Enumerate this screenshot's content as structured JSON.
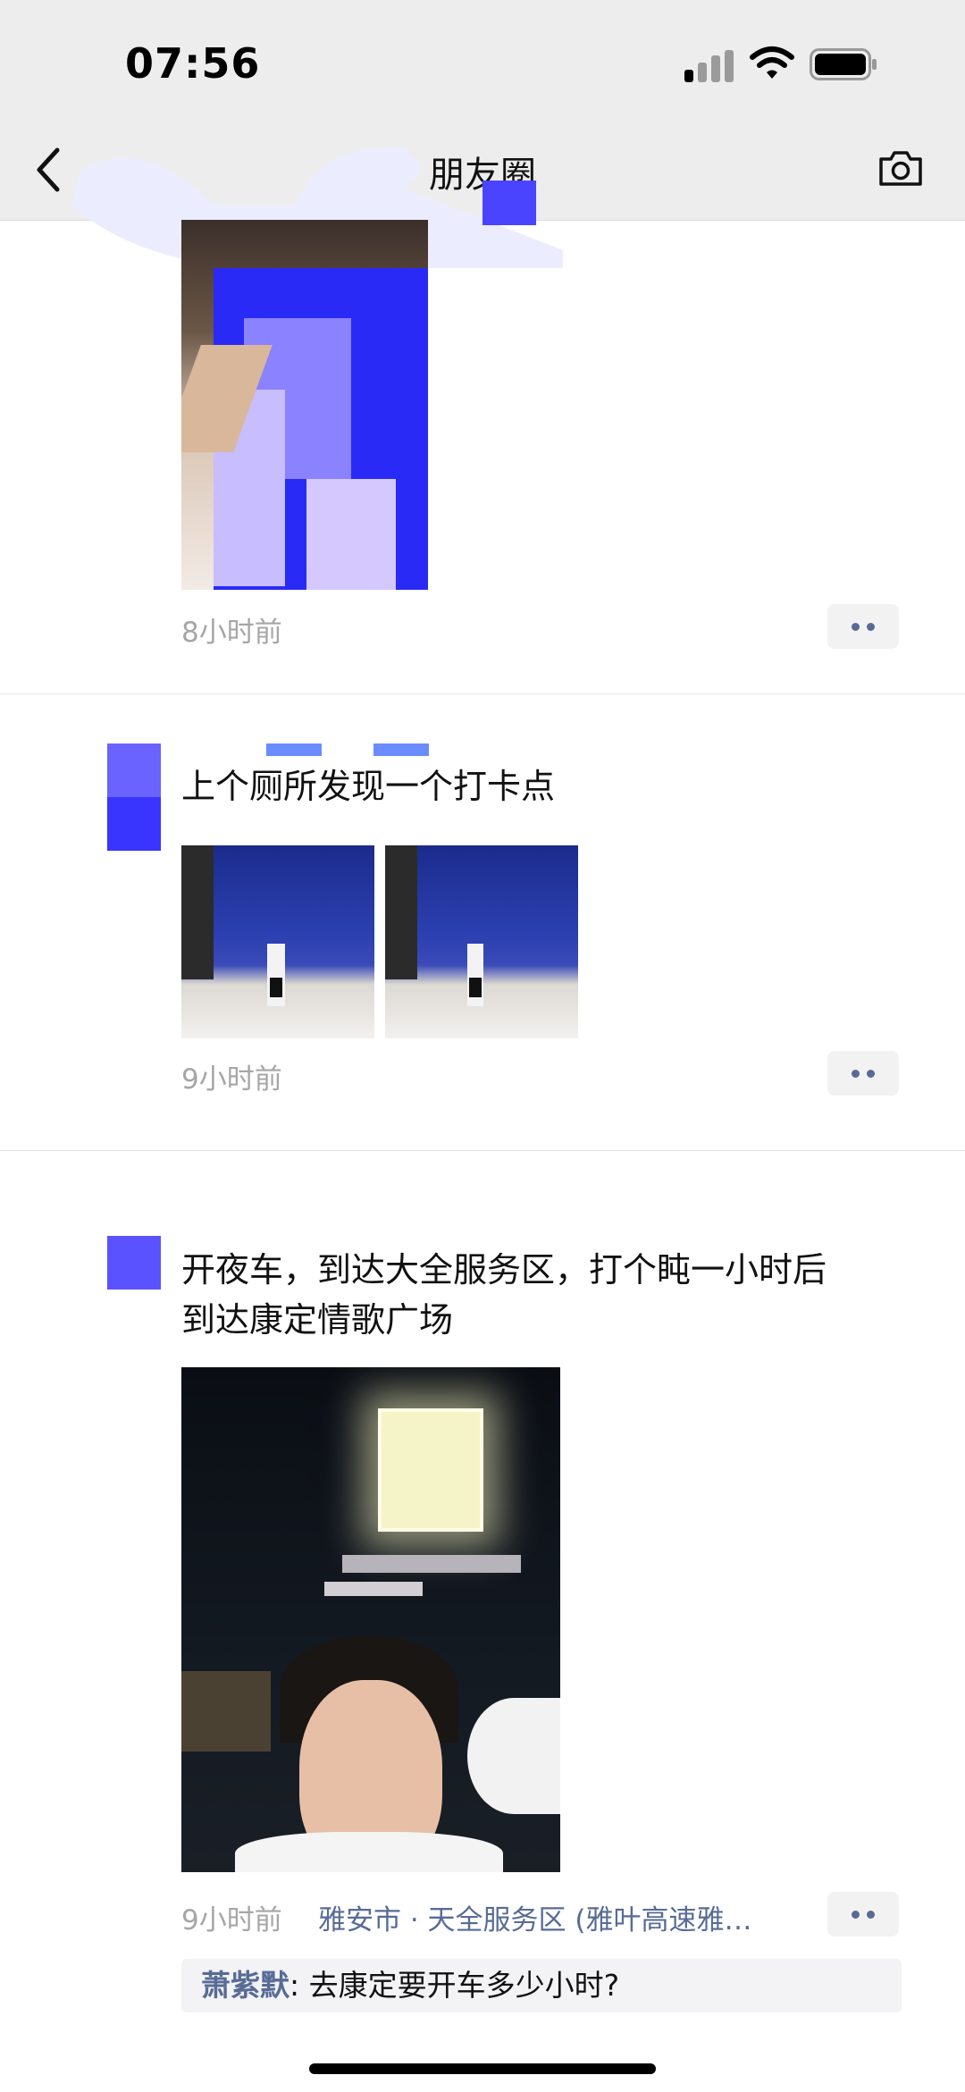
{
  "status_bar": {
    "time": "07:56"
  },
  "nav": {
    "title": "朋友圈"
  },
  "posts": [
    {
      "time": "8小时前"
    },
    {
      "text": "上个厕所发现一个打卡点",
      "time": "9小时前"
    },
    {
      "text": "开夜车，到达大全服务区，打个盹一小时后\n到达康定情歌广场",
      "time": "9小时前",
      "location": "雅安市 · 天全服务区 (雅叶高速雅…",
      "comment": {
        "author": "萧紫默",
        "text": ": 去康定要开车多少小时?"
      }
    }
  ],
  "colors": {
    "link": "#576b95",
    "redaction": "#3a34ff",
    "header_bg": "#ededed"
  },
  "icons": [
    "back-chevron-icon",
    "camera-icon",
    "signal-icon",
    "wifi-icon",
    "battery-icon",
    "more-dots-icon"
  ]
}
